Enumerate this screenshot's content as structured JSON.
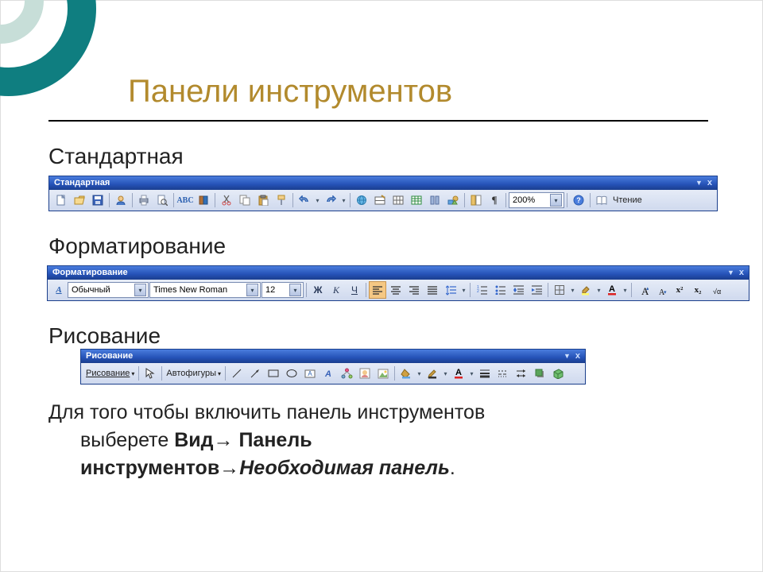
{
  "slide": {
    "title": "Панели инструментов",
    "section1": "Стандартная",
    "section2": "Форматирование",
    "section3": "Рисование",
    "instr_line1": "Для того чтобы включить панель инструментов",
    "instr_line2_pre": "выберете ",
    "instr_bold1": "Вид→ Панель",
    "instr_bold2_pre": "инструментов→",
    "instr_italic": "Необходимая панель",
    "period": "."
  },
  "tb_standard": {
    "title": "Стандартная",
    "zoom": "200%",
    "read": "Чтение"
  },
  "tb_format": {
    "title": "Форматирование",
    "style_hint": "A",
    "style": "Обычный",
    "font": "Times New Roman",
    "size": "12",
    "bold": "Ж",
    "italic": "К",
    "underline": "Ч",
    "super": "x²",
    "sub": "x₂"
  },
  "tb_draw": {
    "title": "Рисование",
    "menu1": "Рисование",
    "menu2": "Автофигуры"
  },
  "ui": {
    "down": "▾",
    "options": "▼",
    "close": "x"
  }
}
